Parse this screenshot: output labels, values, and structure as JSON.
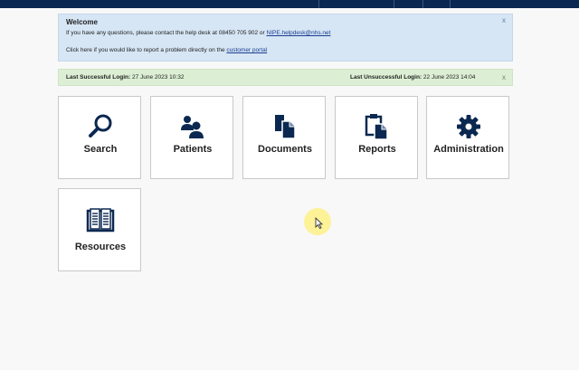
{
  "welcome": {
    "title": "Welcome",
    "line1_text": "If you have any questions, please contact the help desk at 08450 705 902 or ",
    "line1_email": "NIPE.helpdesk@nhs.net",
    "line2_text": "Click here if you would like to report a problem directly on the ",
    "line2_link": "customer portal",
    "close": "x"
  },
  "login": {
    "success_label": "Last Successful Login:",
    "success_value": "27 June 2023 10:32",
    "fail_label": "Last Unsuccessful Login:",
    "fail_value": "22 June 2023 14:04",
    "close": "x"
  },
  "tiles": [
    {
      "label": "Search",
      "icon": "magnifier-icon"
    },
    {
      "label": "Patients",
      "icon": "people-icon"
    },
    {
      "label": "Documents",
      "icon": "documents-icon"
    },
    {
      "label": "Reports",
      "icon": "clipboard-icon"
    },
    {
      "label": "Administration",
      "icon": "gear-icon"
    },
    {
      "label": "Resources",
      "icon": "book-icon"
    }
  ],
  "colors": {
    "icon": "#0b2850",
    "welcome_bg": "#d6e6f5",
    "login_bg": "#dcefd4"
  }
}
